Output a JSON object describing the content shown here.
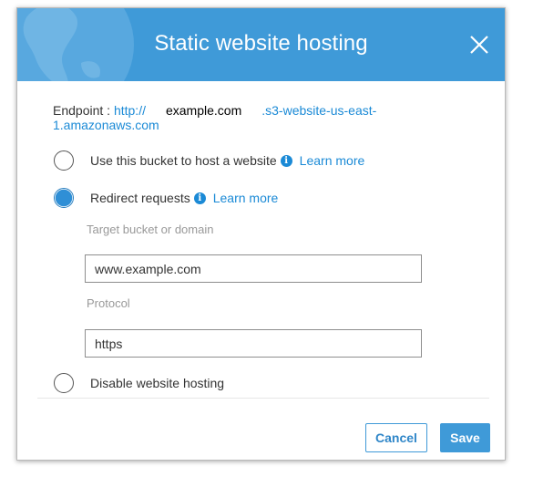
{
  "dialog": {
    "title": "Static website hosting",
    "endpoint": {
      "label": "Endpoint :",
      "url_prefix": "http://",
      "hostname": "example.com",
      "url_suffix": ".s3-website-us-east-",
      "url_line2": "1.amazonaws.com"
    },
    "options": [
      {
        "label": "Use this bucket to host a website",
        "learn_more": "Learn more",
        "selected": false
      },
      {
        "label": "Redirect requests",
        "learn_more": "Learn more",
        "selected": true
      },
      {
        "label": "Disable website hosting",
        "selected": false
      }
    ],
    "redirect": {
      "target_label": "Target bucket or domain",
      "target_value": "www.example.com",
      "protocol_label": "Protocol",
      "protocol_value": "https"
    },
    "buttons": {
      "cancel": "Cancel",
      "save": "Save"
    },
    "colors": {
      "header": "#3f9ad8",
      "link": "#1b8ad6",
      "primary": "#3f9ad8"
    }
  }
}
